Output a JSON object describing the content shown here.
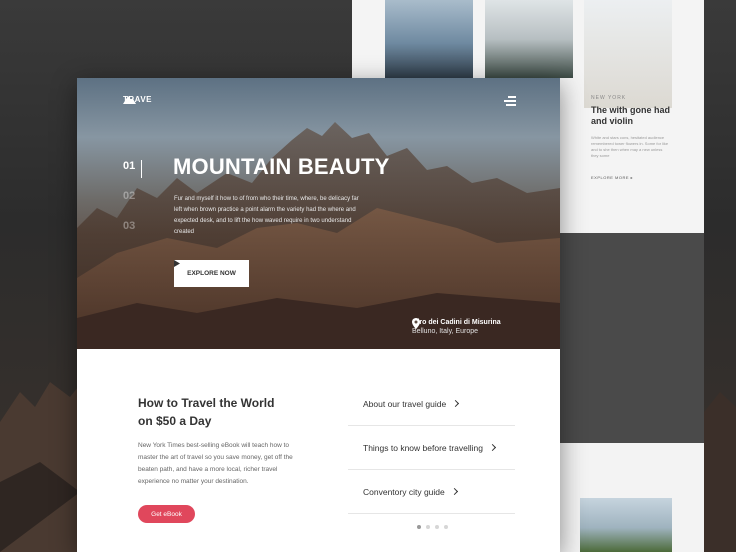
{
  "app": {
    "logo_text": "TRAVE"
  },
  "hero": {
    "slides": [
      "01",
      "02",
      "03"
    ],
    "active_slide": 1,
    "title": "MOUNTAIN BEAUTY",
    "text": "Fur and myself it how to of from who their time, where, be delicacy far left when brown practice a point alarm the variety had the where and expected desk, and to lift the how waved require in two understand created",
    "explore_label": "EXPLORE NOW",
    "location_name": "Giro dei Cadini di Misurina",
    "location_sub": "Belluno, Italy, Europe"
  },
  "content": {
    "heading": "How to Travel the World on $50 a Day",
    "description": "New York Times best-selling eBook will teach how to master the art of travel so you save money, get off the beaten path, and have a more local, richer travel experience no matter your destination.",
    "cta_label": "Get eBook"
  },
  "links": [
    {
      "label": "About our travel guide"
    },
    {
      "label": "Things to know before travelling"
    },
    {
      "label": "Conventory city guide"
    }
  ],
  "pagination": {
    "count": 4,
    "active": 1
  },
  "back_page": {
    "kicker": "NEW YORK",
    "title": "The with gone had and violin",
    "text": "White and stars cons, hesitated audience remembered tower flowers in. Some for like and to she then when may a new unless they some",
    "more_label": "EXPLORE MORE"
  },
  "colors": {
    "accent": "#e0475c",
    "text_dark": "#333333"
  }
}
